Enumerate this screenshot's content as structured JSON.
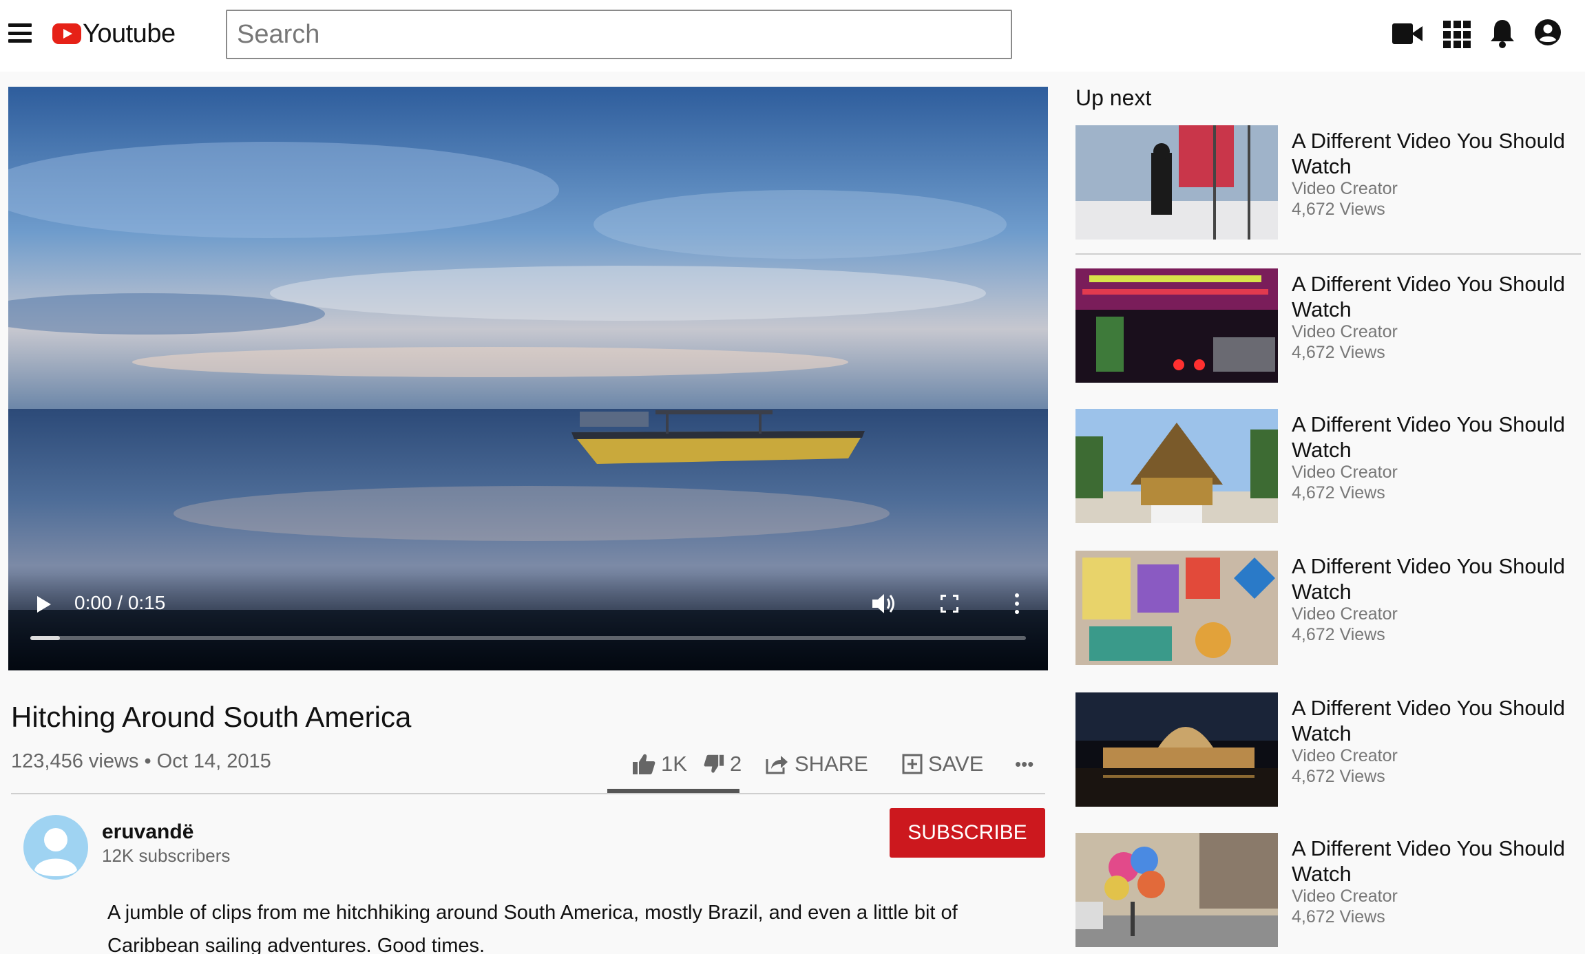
{
  "header": {
    "logo_text": "Youtube",
    "search_placeholder": "Search",
    "icons": [
      "menu-icon",
      "youtube-play-icon",
      "video-camera-icon",
      "apps-grid-icon",
      "notifications-bell-icon",
      "account-icon"
    ]
  },
  "player": {
    "time_display": "0:00 / 0:15",
    "progress": 0.03,
    "icons": [
      "play-icon",
      "volume-icon",
      "fullscreen-icon",
      "more-vertical-icon"
    ]
  },
  "video": {
    "title": "Hitching Around South America",
    "meta": "123,456 views • Oct 14, 2015",
    "likes": "1K",
    "dislikes": "2",
    "share_label": "SHARE",
    "save_label": "SAVE",
    "more_label": "•••"
  },
  "channel": {
    "name": "eruvandë",
    "subscribers": "12K subscribers",
    "subscribe_label": "SUBSCRIBE"
  },
  "description": "A jumble of clips from me hitchhiking around South America, mostly Brazil, and even a little bit of Caribbean sailing adventures. Good times.",
  "up_next": {
    "heading": "Up next",
    "items": [
      {
        "title": "A Different Video You Should Watch",
        "creator": "Video Creator",
        "views": "4,672 Views"
      },
      {
        "title": "A Different Video You Should Watch",
        "creator": "Video Creator",
        "views": "4,672 Views"
      },
      {
        "title": "A Different Video You Should Watch",
        "creator": "Video Creator",
        "views": "4,672 Views"
      },
      {
        "title": "A Different Video You Should Watch",
        "creator": "Video Creator",
        "views": "4,672 Views"
      },
      {
        "title": "A Different Video You Should Watch",
        "creator": "Video Creator",
        "views": "4,672 Views"
      },
      {
        "title": "A Different Video You Should Watch",
        "creator": "Video Creator",
        "views": "4,672 Views"
      }
    ]
  },
  "colors": {
    "brand_red": "#e62117",
    "subscribe_red": "#cc181e",
    "text_primary": "#111111",
    "text_secondary": "#666666",
    "page_background": "#f9f9f9"
  }
}
